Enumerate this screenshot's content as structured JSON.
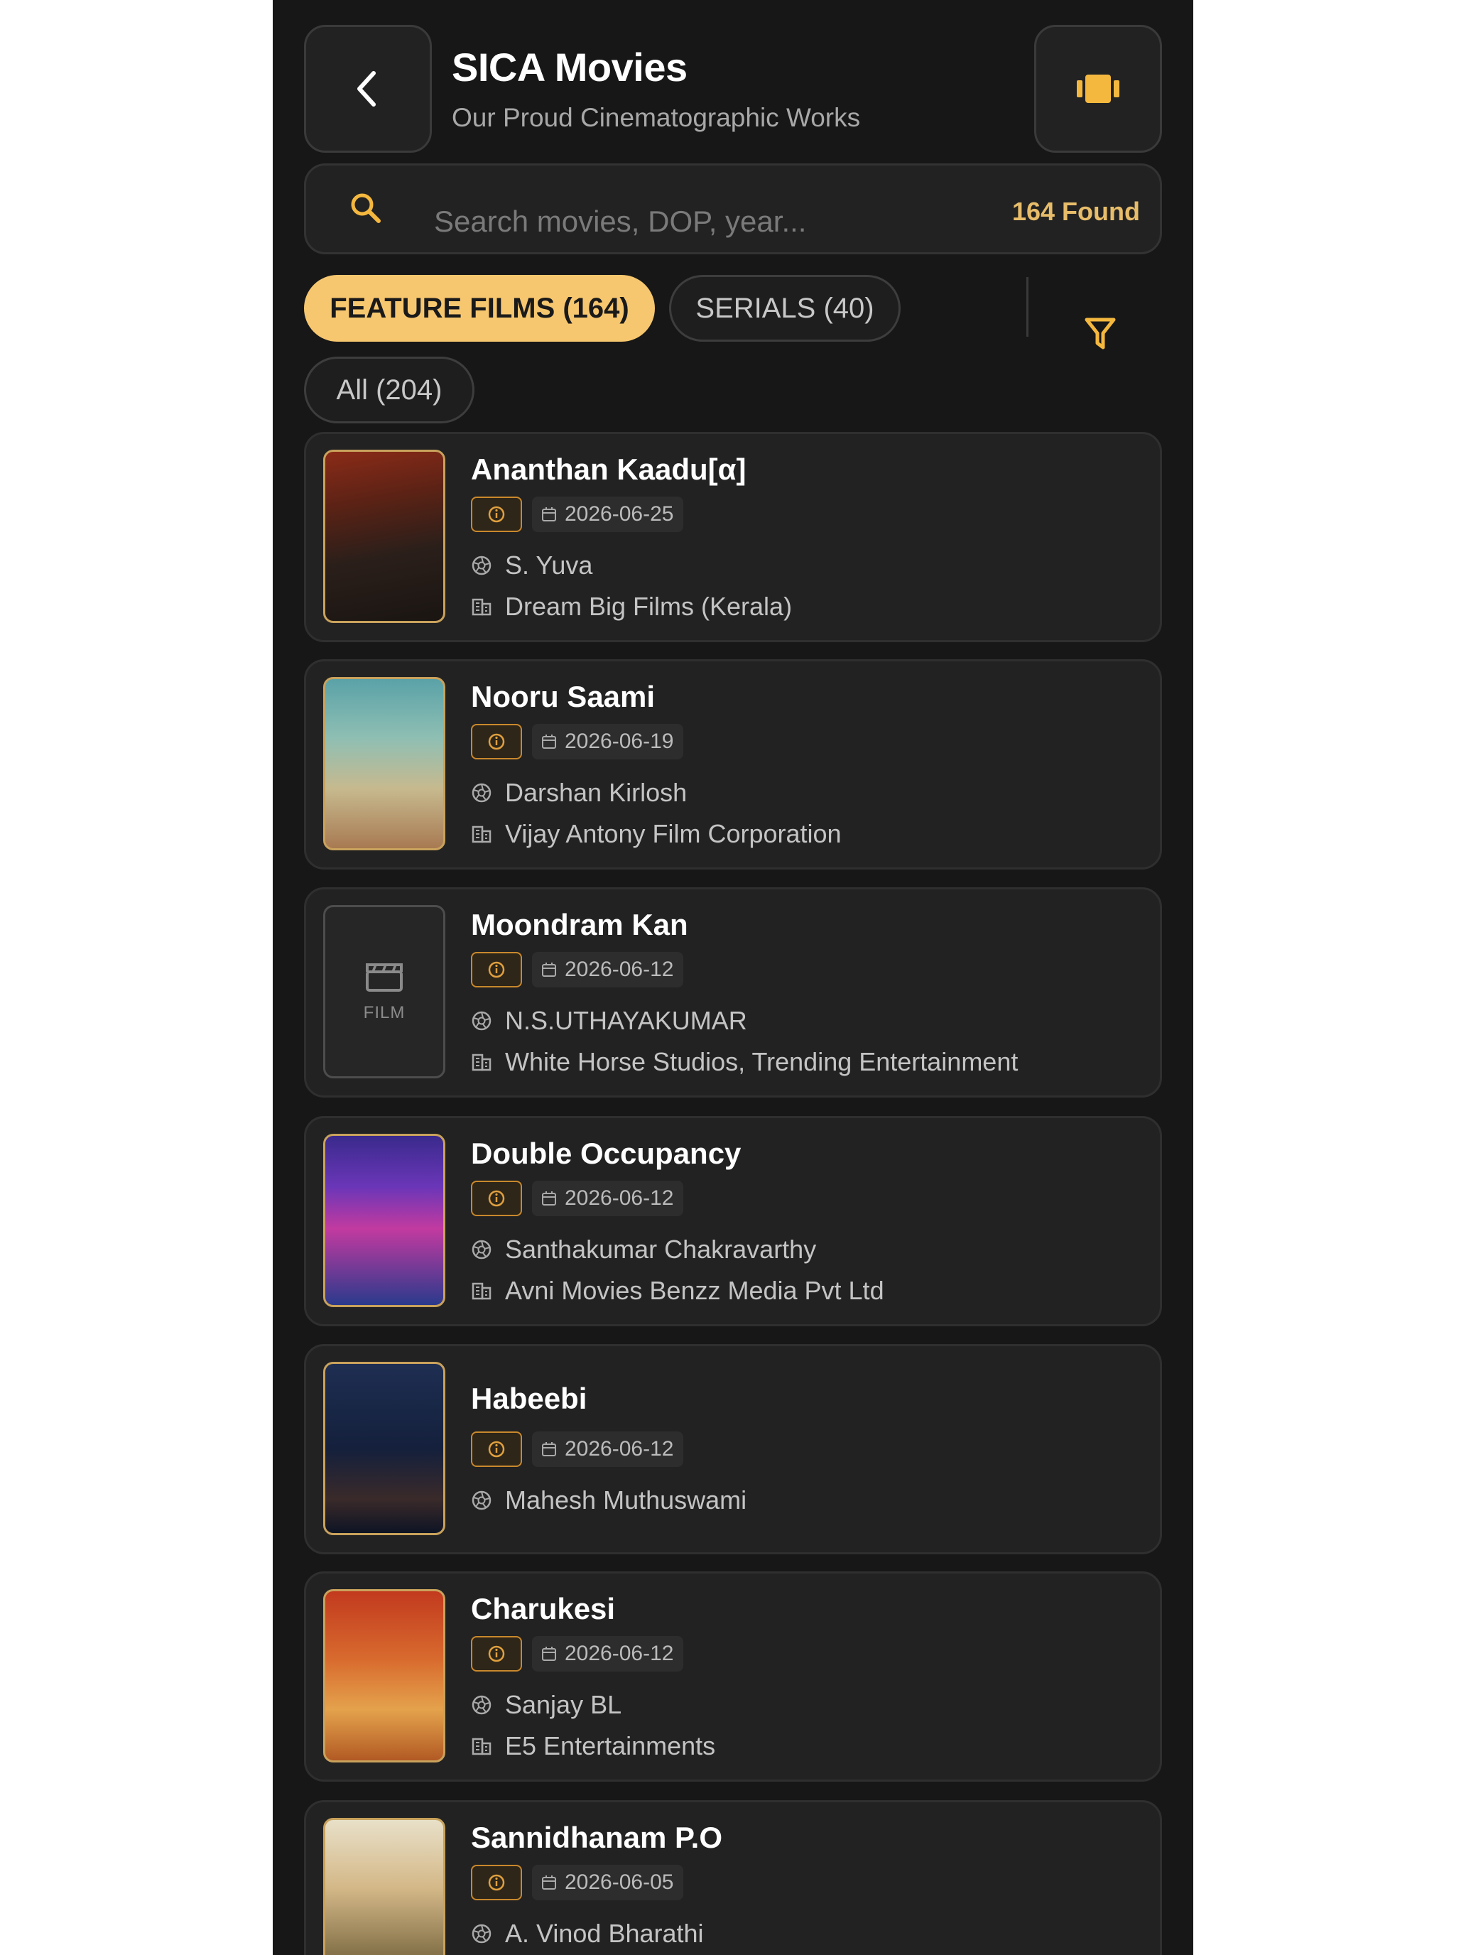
{
  "header": {
    "title": "SICA Movies",
    "subtitle": "Our Proud Cinematographic Works",
    "back_icon": "chevron-left-icon",
    "right_icon": "reels-icon"
  },
  "search": {
    "placeholder": "Search movies, DOP, year...",
    "value": "",
    "found_label": "164 Found"
  },
  "tabs": {
    "feature": "FEATURE FILMS (164)",
    "serials": "SERIALS (40)",
    "all": "All (204)",
    "active": "feature"
  },
  "colors": {
    "background": "#171717",
    "card": "#222222",
    "accent": "#f7c76f",
    "accent_text": "#e8bd6a"
  },
  "movies": [
    {
      "title": "Ananthan Kaadu[α]",
      "date": "2026-06-25",
      "dop": "S. Yuva",
      "production": "Dream Big Films (Kerala)"
    },
    {
      "title": "Nooru Saami",
      "date": "2026-06-19",
      "dop": "Darshan Kirlosh",
      "production": "Vijay Antony Film Corporation"
    },
    {
      "title": "Moondram Kan",
      "date": "2026-06-12",
      "dop": "N.S.UTHAYAKUMAR",
      "production": "White Horse Studios, Trending Entertainment",
      "poster_placeholder": "FILM"
    },
    {
      "title": "Double Occupancy",
      "date": "2026-06-12",
      "dop": "Santhakumar Chakravarthy",
      "production": "Avni Movies Benzz Media Pvt Ltd"
    },
    {
      "title": "Habeebi",
      "date": "2026-06-12",
      "dop": "Mahesh Muthuswami"
    },
    {
      "title": "Charukesi",
      "date": "2026-06-12",
      "dop": "Sanjay BL",
      "production": "E5 Entertainments"
    },
    {
      "title": "Sannidhanam P.O",
      "date": "2026-06-05",
      "dop": "A. Vinod Bharathi"
    }
  ]
}
